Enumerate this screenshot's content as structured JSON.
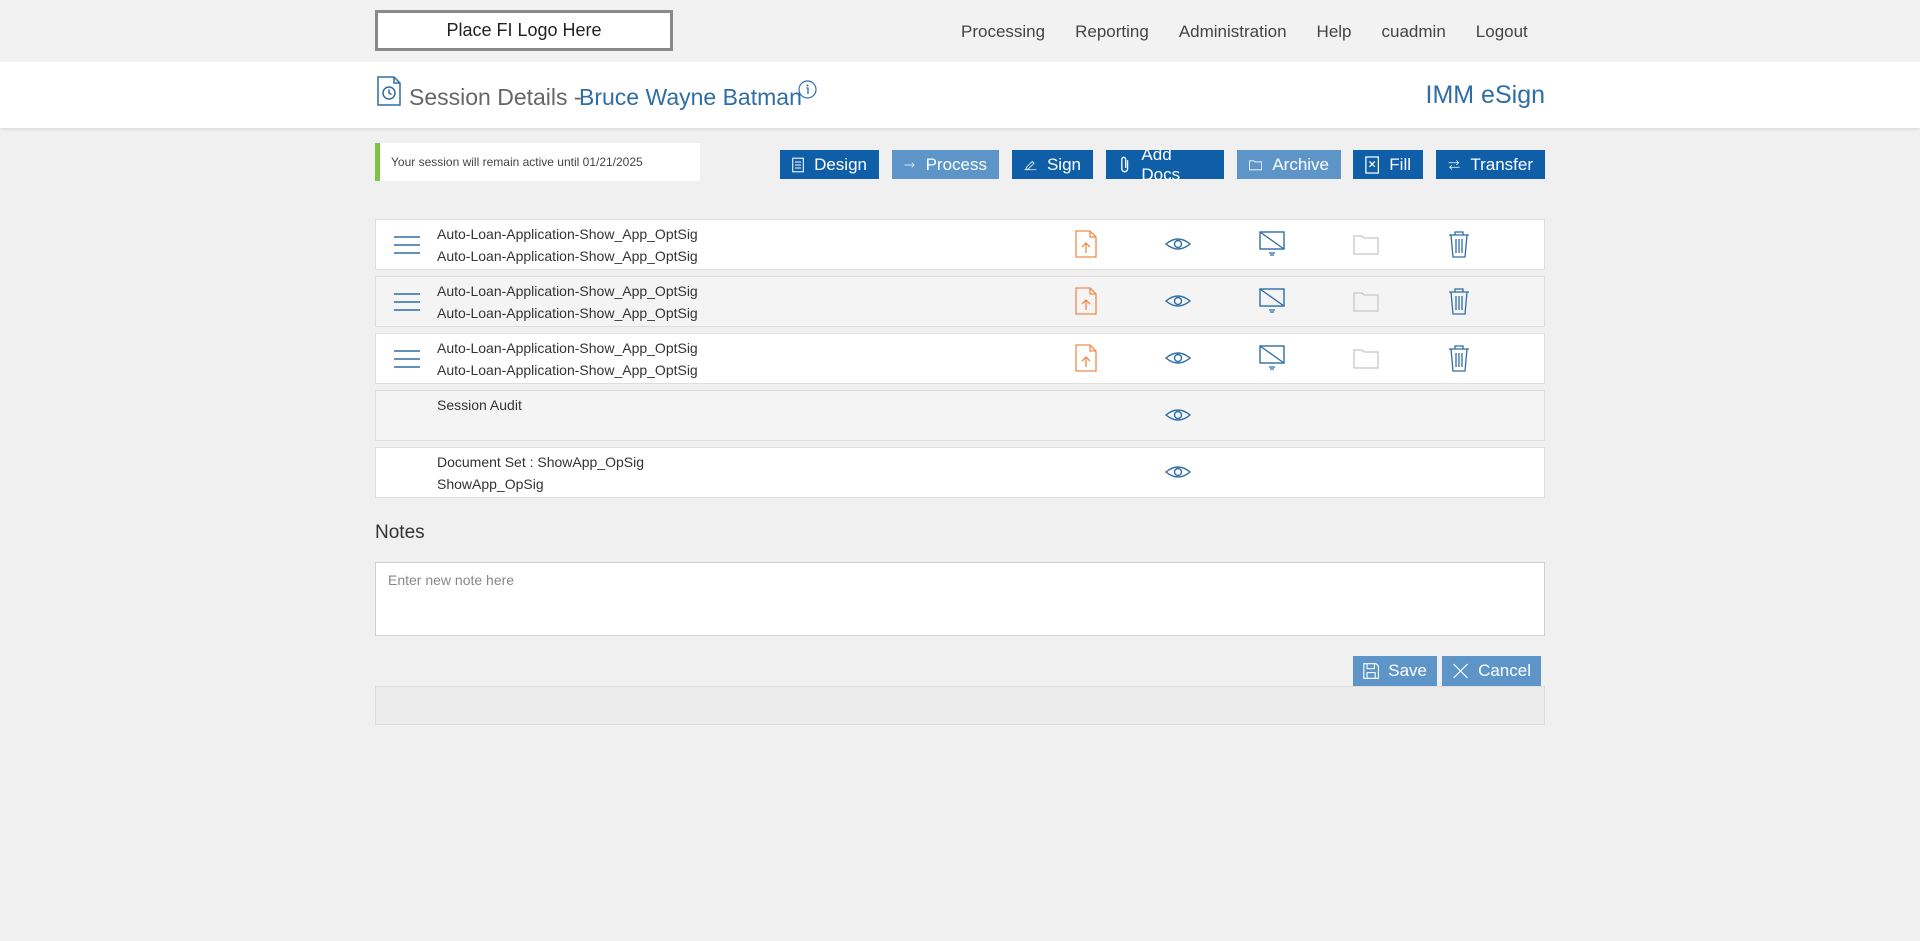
{
  "topnav": {
    "logo_text": "Place FI Logo Here",
    "items": [
      "Processing",
      "Reporting",
      "Administration",
      "Help",
      "cuadmin",
      "Logout"
    ]
  },
  "header": {
    "title": "Session Details -",
    "customer_name": "Bruce Wayne Batman",
    "brand": "IMM eSign"
  },
  "notice": {
    "text": "Your session will remain active until 01/21/2025"
  },
  "toolbar": {
    "design": "Design",
    "process": "Process",
    "sign": "Sign",
    "add_docs": "Add Docs",
    "archive": "Archive",
    "fill": "Fill",
    "transfer": "Transfer"
  },
  "documents": [
    {
      "line1": "Auto-Loan-Application-Show_App_OptSig",
      "line2": "Auto-Loan-Application-Show_App_OptSig"
    },
    {
      "line1": "Auto-Loan-Application-Show_App_OptSig",
      "line2": "Auto-Loan-Application-Show_App_OptSig"
    },
    {
      "line1": "Auto-Loan-Application-Show_App_OptSig",
      "line2": "Auto-Loan-Application-Show_App_OptSig"
    }
  ],
  "audit": {
    "label": "Session Audit"
  },
  "document_set": {
    "line1": "Document Set : ShowApp_OpSig",
    "line2": "ShowApp_OpSig"
  },
  "notes": {
    "title": "Notes",
    "placeholder": "Enter new note here",
    "save": "Save",
    "cancel": "Cancel"
  },
  "colors": {
    "primary_button": "#0f5fa8",
    "secondary_button": "#5d95c9",
    "accent_text": "#2f6da6",
    "upload_icon": "#f08a4b",
    "notice_border": "#7cc243"
  },
  "icons": {
    "doc_actions": [
      "upload-document-icon",
      "eye-icon",
      "monitor-off-icon",
      "folder-icon",
      "trash-icon"
    ]
  }
}
